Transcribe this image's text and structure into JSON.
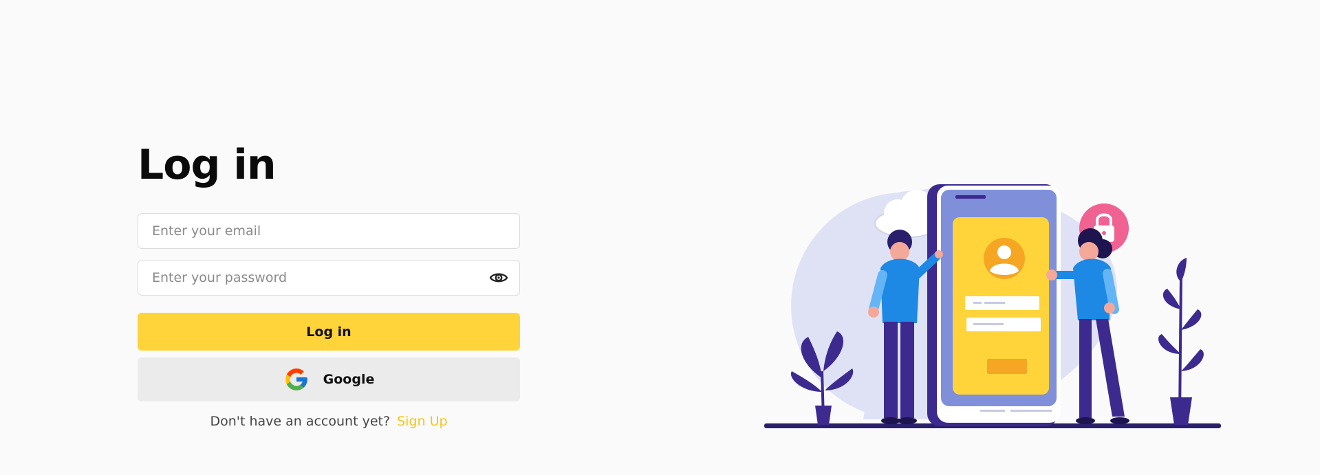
{
  "login": {
    "title": "Log in",
    "email_placeholder": "Enter your email",
    "password_placeholder": "Enter your password",
    "submit_label": "Log in",
    "google_label": "Google",
    "signup_prompt": "Don't have an account yet?",
    "signup_link": "Sign Up"
  },
  "icons": {
    "password_toggle": "eye-icon",
    "google": "google-logo-icon",
    "lock": "padlock-icon"
  },
  "colors": {
    "accent": "#ffd43b",
    "link": "#f5c518",
    "google_button_bg": "#ebebeb",
    "illustration_primary": "#3d2a8f",
    "illustration_secondary": "#dfe2f5",
    "lock_badge": "#f06292",
    "figure_shirt": "#1e88e5"
  }
}
